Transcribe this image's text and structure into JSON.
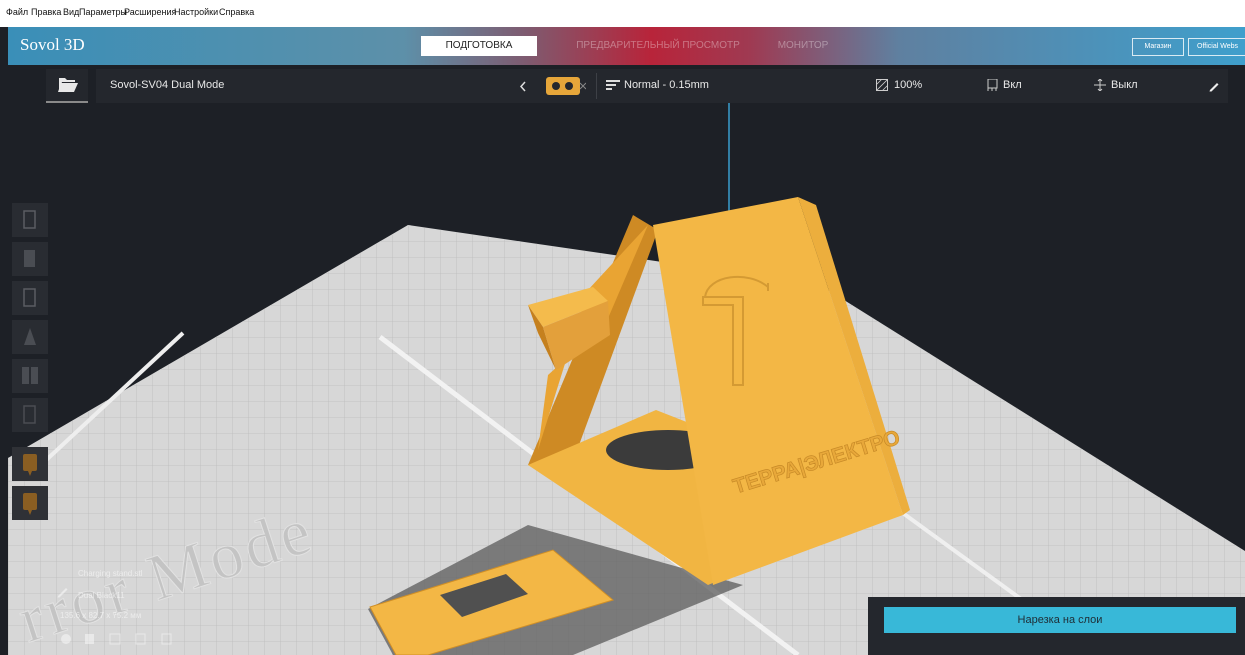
{
  "menubar": {
    "items": [
      "Файл",
      "Правка",
      "Вид",
      "Параметры",
      "Расширения",
      "Настройки",
      "Справка"
    ]
  },
  "header": {
    "app_title": "Sovol 3D",
    "tabs": [
      "ПОДГОТОВКА",
      "ПРЕДВАРИТЕЛЬНЫЙ ПРОСМОТР",
      "МОНИТОР"
    ],
    "active_tab": "ПОДГОТОВКА",
    "marketplace_label": "Магазин",
    "website_label": "Official Webs"
  },
  "toolbar": {
    "printer_name": "Sovol-SV04 Dual Mode",
    "profile": "Normal - 0.15mm",
    "infill": "100%",
    "support": "Вкл",
    "adhesion": "Выкл"
  },
  "viewport": {
    "plate_watermark": "rror Mode",
    "model_logo": "ТЕРРА|ЭЛЕКТРО"
  },
  "object_info": {
    "name": "Charging stand.stl",
    "material": "Dual Black11",
    "dimensions": "135.6 x 82.7 x 75.2 мм"
  },
  "slice": {
    "label": "Нарезка на слои"
  },
  "colors": {
    "accent": "#38b8d8",
    "model": "#f3b745",
    "plate": "#d7d7d7",
    "background": "#1d2026",
    "panel": "#24272d"
  }
}
